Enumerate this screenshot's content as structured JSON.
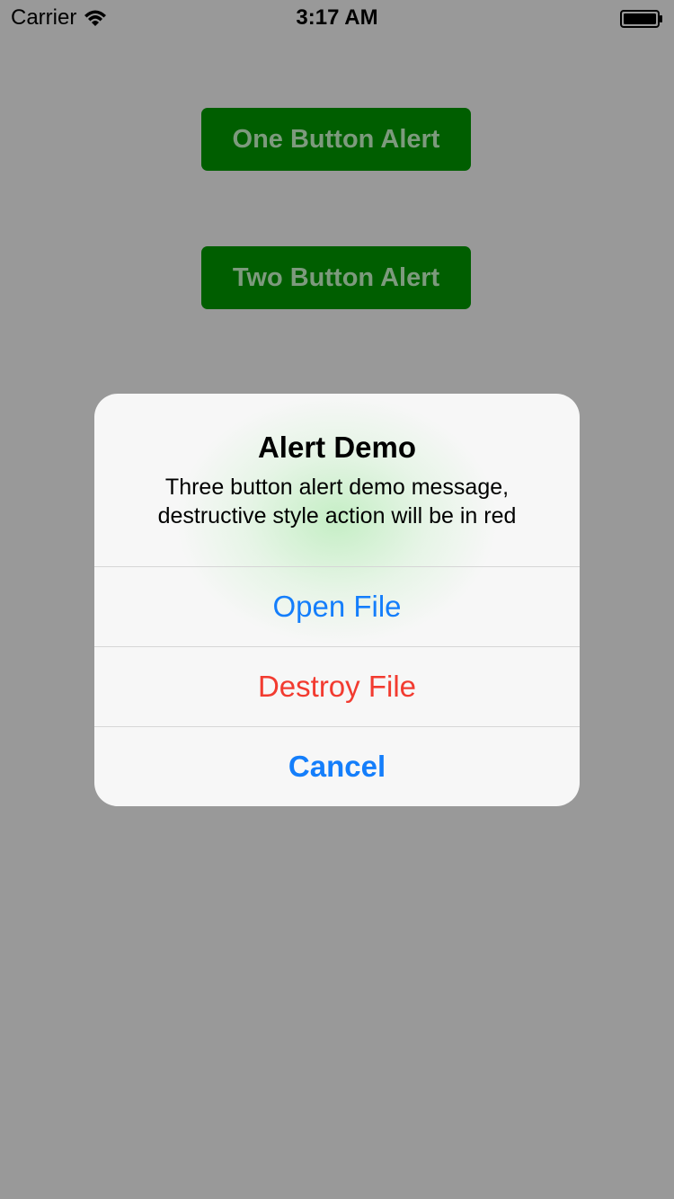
{
  "status_bar": {
    "carrier": "Carrier",
    "time": "3:17 AM",
    "wifi_icon": "wifi-icon",
    "battery_icon": "battery-icon"
  },
  "buttons": {
    "one_button_alert": "One Button Alert",
    "two_button_alert": "Two Button Alert"
  },
  "alert": {
    "title": "Alert Demo",
    "message": "Three button alert demo message, destructive style action will be in red",
    "actions": [
      {
        "label": "Open File",
        "style": "default",
        "color": "#147efb"
      },
      {
        "label": "Destroy File",
        "style": "destructive",
        "color": "#f23b30"
      },
      {
        "label": "Cancel",
        "style": "cancel",
        "color": "#147efb"
      }
    ]
  },
  "colors": {
    "background": "#999999",
    "button_fill": "#005e00",
    "button_text": "#7d9a7d",
    "alert_bg": "#f7f7f7"
  }
}
